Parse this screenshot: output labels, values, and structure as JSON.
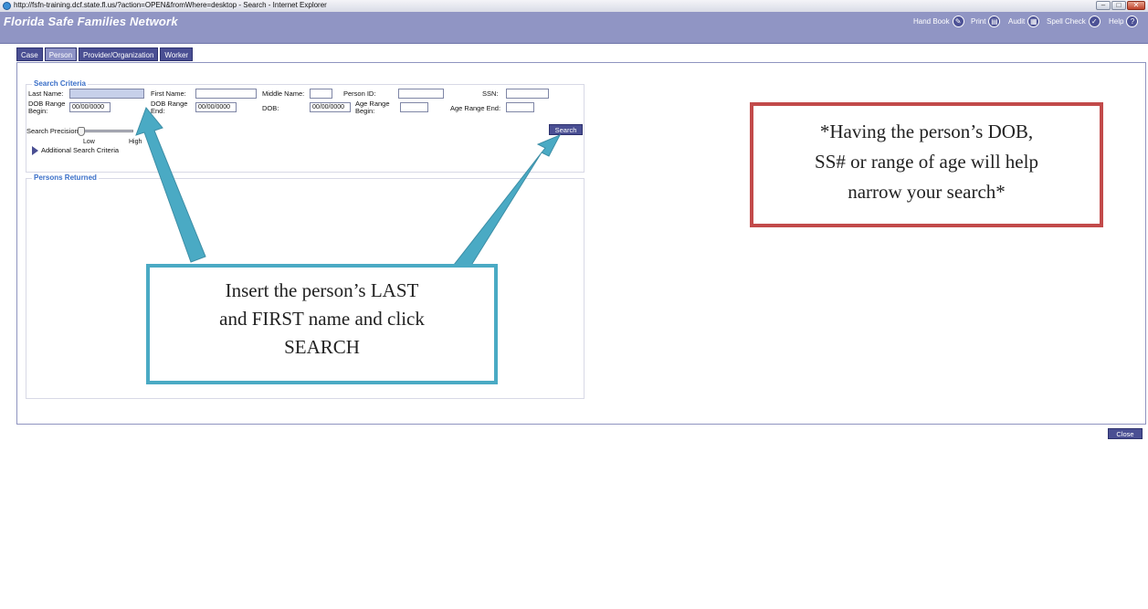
{
  "window": {
    "title": "http://fsfn-training.dcf.state.fl.us/?action=OPEN&fromWhere=desktop - Search - Internet Explorer",
    "controls": {
      "minimize": "–",
      "maximize": "□",
      "close": "✕"
    }
  },
  "app": {
    "name": "Florida Safe Families Network",
    "toolbar": [
      {
        "label": "Hand Book",
        "icon": "✎"
      },
      {
        "label": "Print",
        "icon": "▤"
      },
      {
        "label": "Audit",
        "icon": "▦"
      },
      {
        "label": "Spell Check",
        "icon": "✓"
      },
      {
        "label": "Help",
        "icon": "?"
      }
    ]
  },
  "tabs": [
    {
      "label": "Case",
      "active": false
    },
    {
      "label": "Person",
      "active": true
    },
    {
      "label": "Provider/Organization",
      "active": false
    },
    {
      "label": "Worker",
      "active": false
    }
  ],
  "search": {
    "legend": "Search Criteria",
    "last_name_label": "Last Name:",
    "first_name_label": "First Name:",
    "middle_name_label": "Middle Name:",
    "person_id_label": "Person ID:",
    "ssn_label": "SSN:",
    "dob_begin_label_1": "DOB Range",
    "dob_begin_label_2": "Begin:",
    "dob_begin_value": "00/00/0000",
    "dob_end_label_1": "DOB Range",
    "dob_end_label_2": "End:",
    "dob_end_value": "00/00/0000",
    "dob_label": "DOB:",
    "dob_value": "00/00/0000",
    "age_begin_label_1": "Age Range",
    "age_begin_label_2": "Begin:",
    "age_end_label": "Age Range End:",
    "precision_label": "Search Precision:",
    "precision_low": "Low",
    "precision_high": "High",
    "additional_label": "Additional Search Criteria",
    "search_button": "Search"
  },
  "results": {
    "legend": "Persons Returned"
  },
  "close_button": "Close",
  "callouts": {
    "teal_line1": "Insert the person’s LAST",
    "teal_line2": "and FIRST name and click",
    "teal_line3": "SEARCH",
    "red_line1": "*Having the person’s DOB,",
    "red_line2": "SS# or range of age will help",
    "red_line3": "narrow your search*"
  },
  "colors": {
    "app_header": "#9095c4",
    "tab": "#4a4f93",
    "legend_text": "#3a6fc8",
    "arrow": "#4aaac4",
    "callout_red": "#c24a4a"
  }
}
